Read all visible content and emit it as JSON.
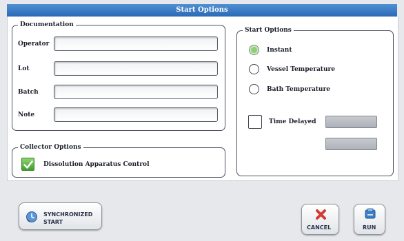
{
  "window": {
    "title": "Start Options"
  },
  "documentation": {
    "title": "Documentation",
    "fields": [
      {
        "label": "Operator",
        "value": ""
      },
      {
        "label": "Lot",
        "value": ""
      },
      {
        "label": "Batch",
        "value": ""
      },
      {
        "label": "Note",
        "value": ""
      }
    ]
  },
  "collector": {
    "title": "Collector Options",
    "checkbox_label": "Dissolution Apparatus Control",
    "checked": true
  },
  "start_options": {
    "title": "Start Options",
    "options": [
      {
        "label": "Instant",
        "selected": true
      },
      {
        "label": "Vessel Temperature",
        "selected": false
      },
      {
        "label": "Bath Temperature",
        "selected": false
      }
    ],
    "time_delayed_label": "Time Delayed",
    "time_delayed_checked": false
  },
  "buttons": {
    "synchronized_line1": "SYNCHRONIZED",
    "synchronized_line2": "START",
    "cancel": "CANCEL",
    "run": "RUN"
  },
  "colors": {
    "title_bar": "#2a6ab7",
    "check_green": "#3f9e2d",
    "cancel_red": "#d53a33",
    "run_blue": "#3d7fc6"
  },
  "icons": {
    "synchronized": "sync-clock-icon",
    "cancel": "red-x-icon",
    "run": "blue-run-icon"
  }
}
